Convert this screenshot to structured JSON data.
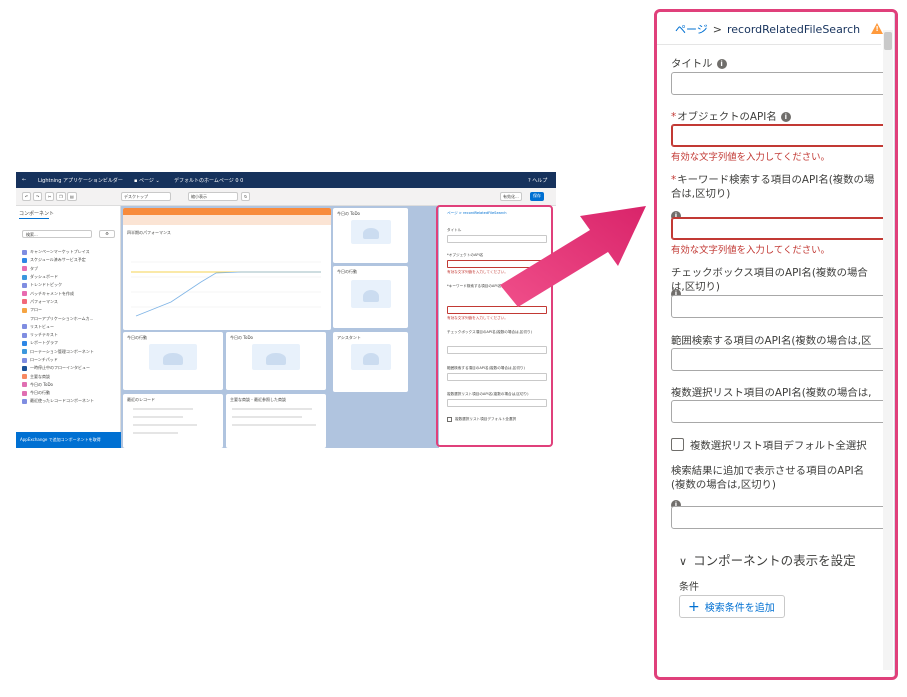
{
  "mini": {
    "app_title": "Lightning アプリケーションビルダー",
    "page_menu": "ページ",
    "page_name": "デフォルトのホームページ 0 0",
    "help": "ヘルプ",
    "device": "デスクトップ",
    "zoom": "縮小表示",
    "activate": "有効化...",
    "save": "保存",
    "components_header": "コンポーネント",
    "search_placeholder": "検索...",
    "components": [
      "キャンペーンマーケットプレイス",
      "スケジュール済みサービス予定",
      "タブ",
      "ダッシュボード",
      "トレンドトピック",
      "バッチキャメントを作成",
      "パフォーマンス",
      "フロー",
      "フローアプリケーションホームカ...",
      "リストビュー",
      "リッチテキスト",
      "レポートグラフ",
      "ローテーション管理コンポーネント",
      "ローンチパッド",
      "一時停止中のフローインタビュー",
      "主要な商談",
      "今日の ToDo",
      "今日の行動",
      "最近使ったレコードコンポーネント"
    ],
    "appexchange": "AppExchange で追加コンポーネントを取得",
    "cards": {
      "performance": "四半期のパフォーマンス",
      "todo": "今日の ToDo",
      "events": "今日の行動",
      "assistant": "アシスタント",
      "recent": "最近のレコード",
      "deals": "主要な商談 - 最近参照した商談"
    },
    "prop": {
      "breadcrumb_page": "ページ",
      "breadcrumb_title": "recordRelatedFileSearch",
      "title_label": "タイトル",
      "obj_label": "*オブジェクトのAPI名",
      "error": "有効な文字列値を入力してください。",
      "kw_label": "*キーワード検索する項目のAPI名(複数の場合は,区切り)",
      "cb_label": "チェックボックス項目のAPI名(複数の場合は,区切り)",
      "range_label": "範囲検索する項目のAPI名(複数の場合は,区切り)",
      "multi_label": "複数選択リスト項目のAPI名(複数の場合は,区切り)",
      "default_label": "複数選択リスト項目デフォルト全選択"
    }
  },
  "panel": {
    "breadcrumb_page": "ページ",
    "breadcrumb_sep": ">",
    "breadcrumb_title": "recordRelatedFileSearch",
    "fields": {
      "title": {
        "label": "タイトル"
      },
      "object_api": {
        "required": "*",
        "label": "オブジェクトのAPI名",
        "error": "有効な文字列値を入力してください。"
      },
      "keyword_api": {
        "required": "*",
        "label": "キーワード検索する項目のAPI名(複数の場合は,区切り)",
        "error": "有効な文字列値を入力してください。"
      },
      "checkbox_api": {
        "label": "チェックボックス項目のAPI名(複数の場合は,区切り)"
      },
      "range_api": {
        "label": "範囲検索する項目のAPI名(複数の場合は,区切り)"
      },
      "multiselect_api": {
        "label": "複数選択リスト項目のAPI名(複数の場合は,区切り)"
      },
      "multiselect_default": {
        "label": "複数選択リスト項目デフォルト全選択",
        "checked": false
      },
      "extra_api": {
        "label": "検索結果に追加で表示させる項目のAPI名(複数の場合は,区切り)"
      }
    },
    "visibility_section": "コンポーネントの表示を設定",
    "conditions_label": "条件",
    "add_condition_button": "検索条件を追加"
  },
  "colors": {
    "accent_pink": "#e0407b",
    "brand_blue": "#0070d2",
    "error_red": "#c23934",
    "header_navy": "#16325c"
  }
}
